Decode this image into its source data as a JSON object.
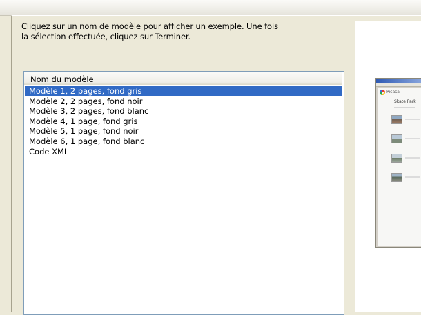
{
  "instructions": {
    "line1": "Cliquez sur un nom de modèle pour afficher un exemple. Une fois",
    "line2": "la sélection effectuée, cliquez sur Terminer."
  },
  "list": {
    "column_header": "Nom du modèle",
    "selected_index": 0,
    "items": [
      "Modèle 1, 2 pages, fond gris",
      "Modèle 2, 2 pages, fond noir",
      "Modèle 3, 2 pages, fond blanc",
      "Modèle 4, 1 page, fond gris",
      "Modèle 5, 1 page, fond noir",
      "Modèle 6, 1 page, fond blanc",
      "Code XML"
    ]
  },
  "preview": {
    "brand": "Picasa",
    "heading": "Skate Park"
  },
  "colors": {
    "dialog_bg": "#ece9d8",
    "selection_bg": "#316ac5",
    "list_border": "#7f9db9"
  }
}
